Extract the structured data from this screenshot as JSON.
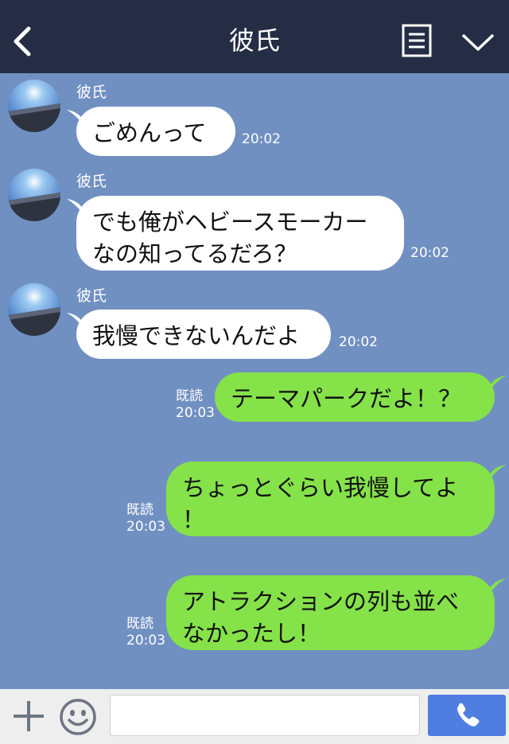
{
  "header": {
    "title": "彼氏",
    "back_icon": "chevron-left-icon",
    "menu_icon": "document-list-icon",
    "collapse_icon": "chevron-down-icon"
  },
  "messages": [
    {
      "direction": "in",
      "sender": "彼氏",
      "text": "ごめんって",
      "time": "20:02"
    },
    {
      "direction": "in",
      "sender": "彼氏",
      "lines": [
        "でも俺がヘビースモーカー",
        "なの知ってるだろ？"
      ],
      "time": "20:02"
    },
    {
      "direction": "in",
      "sender": "彼氏",
      "text": "我慢できないんだよ",
      "time": "20:02"
    },
    {
      "direction": "out",
      "text": "テーマパークだよ！？",
      "read": "既読",
      "time": "20:03"
    },
    {
      "direction": "out",
      "lines": [
        "ちょっとぐらい我慢してよ",
        "！"
      ],
      "read": "既読",
      "time": "20:03"
    },
    {
      "direction": "out",
      "lines": [
        "アトラクションの列も並べ",
        "なかったし！"
      ],
      "read": "既読",
      "time": "20:03"
    }
  ],
  "footer": {
    "input_value": "",
    "plus_icon": "plus-icon",
    "emoji_icon": "smiley-icon",
    "call_icon": "phone-icon"
  },
  "colors": {
    "background": "#7190c2",
    "header": "#252d45",
    "incoming_bubble": "#ffffff",
    "outgoing_bubble": "#85e249",
    "call_button": "#4f7ee0"
  }
}
